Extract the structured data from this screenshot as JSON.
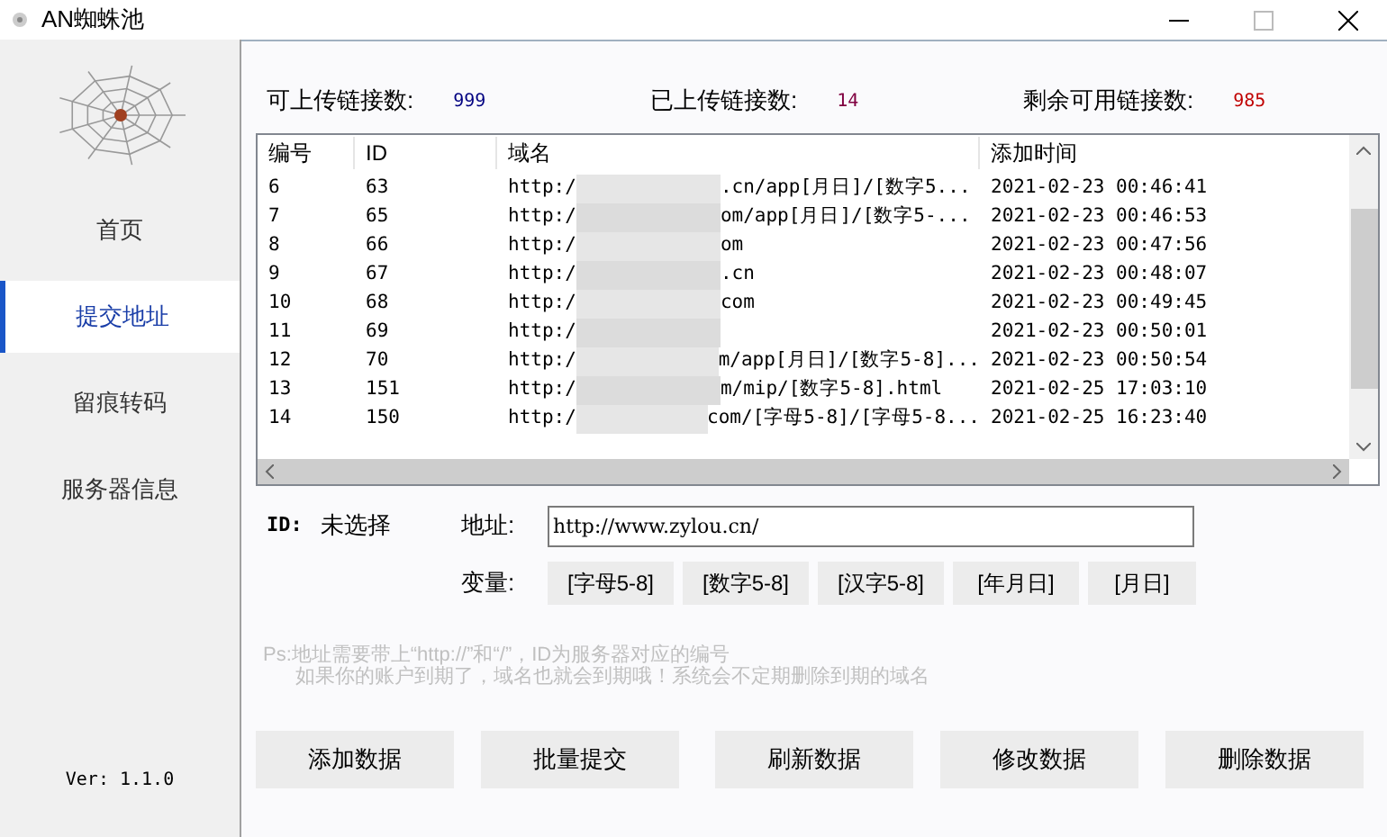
{
  "window": {
    "title": "AN蜘蛛池"
  },
  "sidebar": {
    "items": [
      {
        "label": "首页",
        "selected": false
      },
      {
        "label": "提交地址",
        "selected": true
      },
      {
        "label": "留痕转码",
        "selected": false
      },
      {
        "label": "服务器信息",
        "selected": false
      }
    ],
    "version": "Ver: 1.1.0"
  },
  "stats": [
    {
      "label": "可上传链接数:",
      "value": "999",
      "color": "#000080"
    },
    {
      "label": "已上传链接数:",
      "value": "14",
      "color": "#800040"
    },
    {
      "label": "剩余可用链接数:",
      "value": "985",
      "color": "#c00000"
    }
  ],
  "table": {
    "columns": [
      "编号",
      "ID",
      "域名",
      "添加时间"
    ],
    "rows": [
      {
        "no": "6",
        "id": "63",
        "domain_start": "http:/",
        "domain_end": ".cn/app[月日]/[数字5...",
        "time": "2021-02-23 00:46:41"
      },
      {
        "no": "7",
        "id": "65",
        "domain_start": "http:/",
        "domain_end": "om/app[月日]/[数字5-...",
        "time": "2021-02-23 00:46:53"
      },
      {
        "no": "8",
        "id": "66",
        "domain_start": "http:/",
        "domain_end": "om",
        "time": "2021-02-23 00:47:56"
      },
      {
        "no": "9",
        "id": "67",
        "domain_start": "http:/",
        "domain_end": ".cn",
        "time": "2021-02-23 00:48:07"
      },
      {
        "no": "10",
        "id": "68",
        "domain_start": "http:/",
        "domain_end": "com",
        "time": "2021-02-23 00:49:45"
      },
      {
        "no": "11",
        "id": "69",
        "domain_start": "http:/",
        "domain_end": "",
        "time": "2021-02-23 00:50:01"
      },
      {
        "no": "12",
        "id": "70",
        "domain_start": "http:/",
        "domain_end": "m/app[月日]/[数字5-8]...",
        "time": "2021-02-23 00:50:54"
      },
      {
        "no": "13",
        "id": "151",
        "domain_start": "http:/",
        "domain_end": "m/mip/[数字5-8].html",
        "time": "2021-02-25 17:03:10"
      },
      {
        "no": "14",
        "id": "150",
        "domain_start": "http:/",
        "domain_end": "com/[字母5-8]/[字母5-8...",
        "time": "2021-02-25 16:23:40"
      }
    ]
  },
  "form": {
    "id_label": "ID:",
    "id_value": "未选择",
    "address_label": "地址:",
    "address_value": "http://www.zylou.cn/",
    "variables_label": "变量:",
    "variables": [
      "[字母5-8]",
      "[数字5-8]",
      "[汉字5-8]",
      "[年月日]",
      "[月日]"
    ]
  },
  "notes": [
    "Ps:地址需要带上“http://”和“/”，ID为服务器对应的编号",
    "如果你的账户到期了，域名也就会到期哦！系统会不定期删除到期的域名"
  ],
  "actions": [
    "添加数据",
    "批量提交",
    "刷新数据",
    "修改数据",
    "删除数据"
  ]
}
